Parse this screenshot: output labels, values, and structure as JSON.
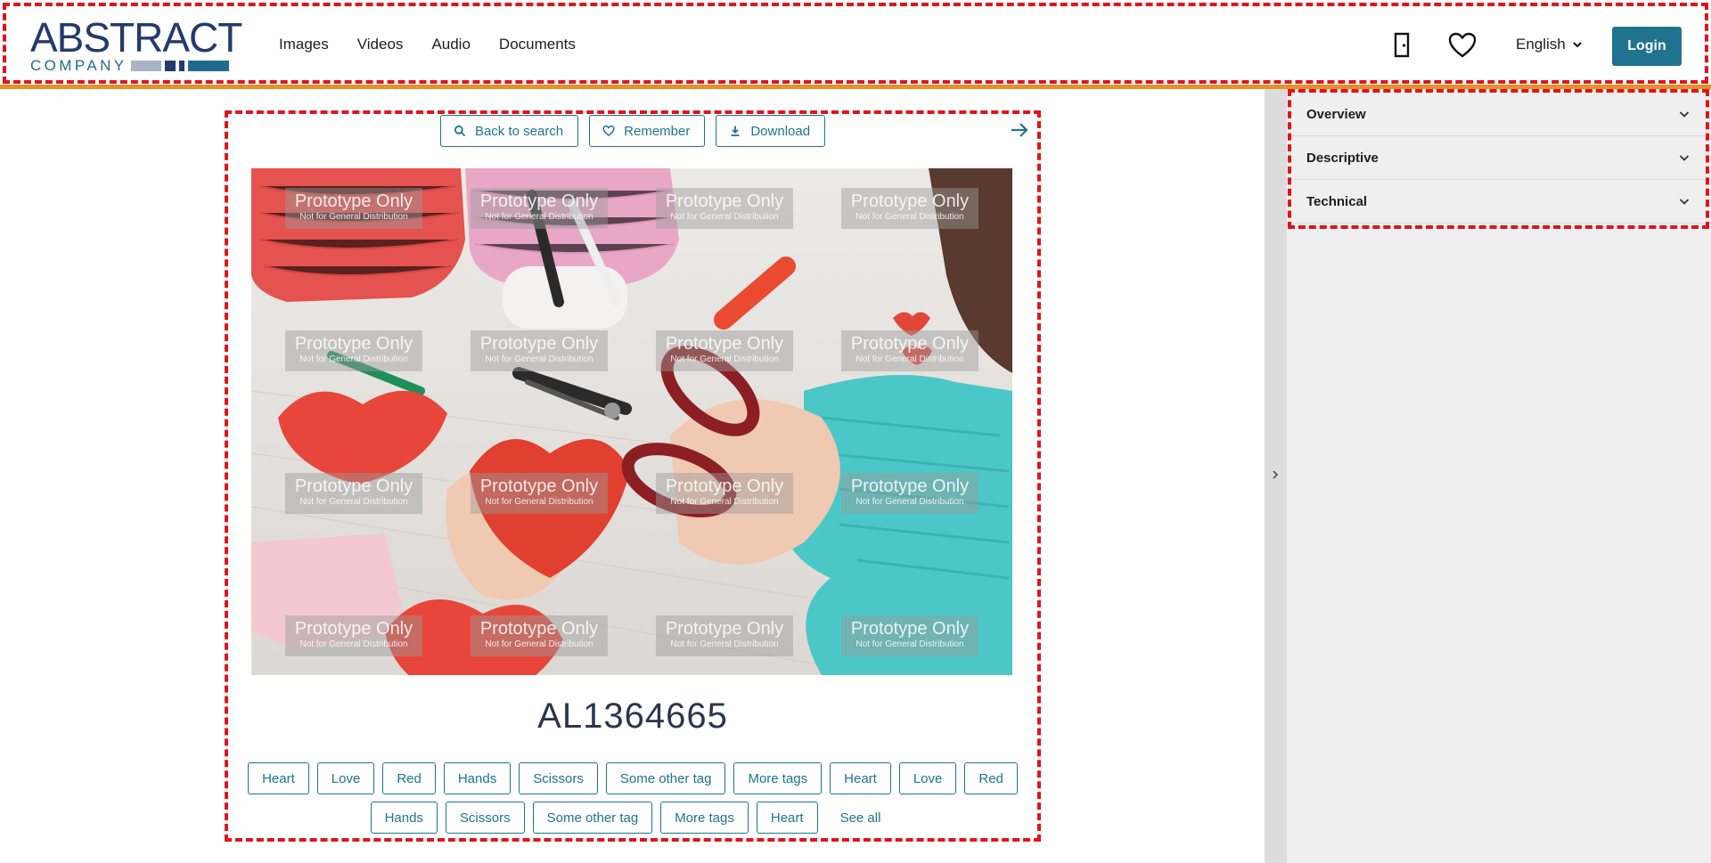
{
  "header": {
    "logo": {
      "word": "ABSTRACT",
      "sub": "COMPANY"
    },
    "nav": [
      {
        "label": "Images"
      },
      {
        "label": "Videos"
      },
      {
        "label": "Audio"
      },
      {
        "label": "Documents"
      }
    ],
    "icons": {
      "exit": "door-exit-icon",
      "favorites": "heart-icon"
    },
    "language": "English",
    "login_label": "Login"
  },
  "toolbar": {
    "back_label": "Back to search",
    "remember_label": "Remember",
    "download_label": "Download"
  },
  "asset": {
    "id": "AL1364665",
    "watermark_title": "Prototype Only",
    "watermark_sub": "Not for General Distribution"
  },
  "tags": [
    "Heart",
    "Love",
    "Red",
    "Hands",
    "Scissors",
    "Some other tag",
    "More tags",
    "Heart",
    "Love",
    "Red",
    "Hands",
    "Scissors",
    "Some other tag",
    "More tags",
    "Heart"
  ],
  "see_all_label": "See all",
  "panel": {
    "sections": [
      {
        "label": "Overview"
      },
      {
        "label": "Descriptive"
      },
      {
        "label": "Technical"
      }
    ]
  },
  "colors": {
    "accent": "#20738e",
    "brand_navy": "#243a6b",
    "header_rule": "#e8902a",
    "highlight_outline": "#e0141b"
  }
}
